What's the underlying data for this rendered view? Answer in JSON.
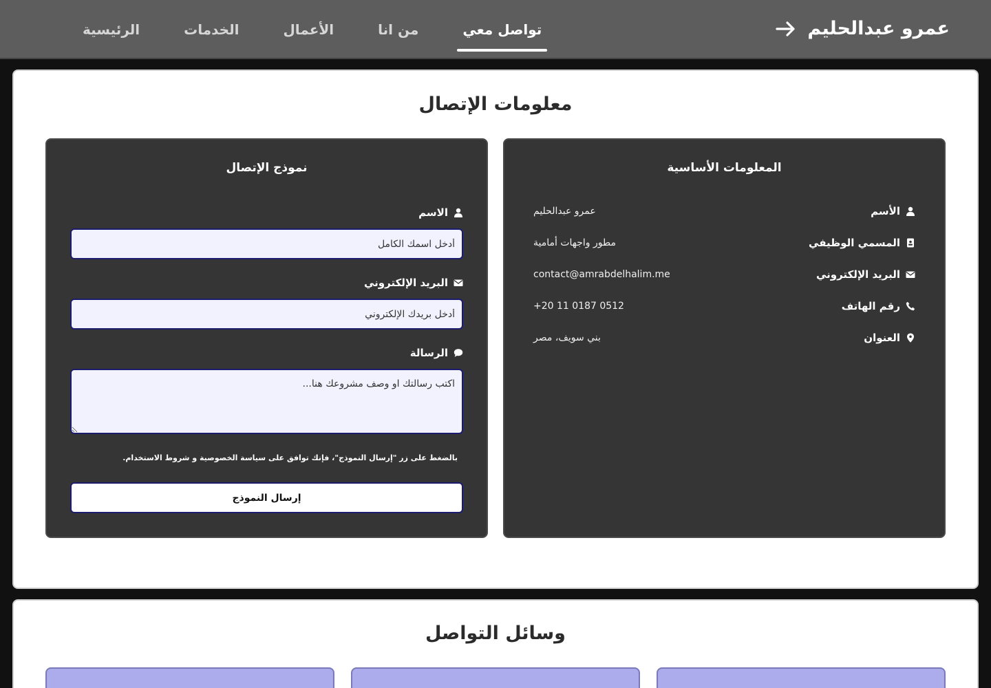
{
  "header": {
    "brand_name": "عمرو عبدالحليم",
    "nav": [
      {
        "label": "الرئيسية",
        "active": false
      },
      {
        "label": "الخدمات",
        "active": false
      },
      {
        "label": "الأعمال",
        "active": false
      },
      {
        "label": "من انا",
        "active": false
      },
      {
        "label": "تواصل معي",
        "active": true
      }
    ]
  },
  "contact_info": {
    "title": "معلومات الإتصال",
    "basic": {
      "title": "المعلومات الأساسية",
      "rows": [
        {
          "label": "الأسم",
          "value": "عمرو عبدالحليم",
          "icon": "user-icon"
        },
        {
          "label": "المسمي الوظيفي",
          "value": "مطور واجهات أمامية",
          "icon": "id-badge-icon"
        },
        {
          "label": "البريد الإلكتروني",
          "value": "contact@amrabdelhalim.me",
          "icon": "envelope-icon"
        },
        {
          "label": "رقم الهاتف",
          "value": "+20 11 0187 0512",
          "icon": "phone-icon"
        },
        {
          "label": "العنوان",
          "value": "بني سويف، مصر",
          "icon": "location-pin-icon"
        }
      ]
    },
    "form": {
      "title": "نموذج الإتصال",
      "name_label": "الاسم",
      "name_placeholder": "أدخل اسمك الكامل",
      "email_label": "البريد الإلكتروني",
      "email_placeholder": "أدخل بريدك الإلكتروني",
      "message_label": "الرسالة",
      "message_placeholder": "اكتب رسالتك او وصف مشروعك هنا...",
      "terms": "بالضغط على زر \"إرسال النموذج\"، فإنك توافق على سياسة الخصوصية و شروط الاستخدام.",
      "submit_label": "إرسال النموذج"
    }
  },
  "social": {
    "title": "وسائل التواصل"
  },
  "colors": {
    "header_bg": "#5d5d5d",
    "card_bg": "#353535",
    "field_border": "#1c1c6e",
    "social_card": "#acacec"
  }
}
